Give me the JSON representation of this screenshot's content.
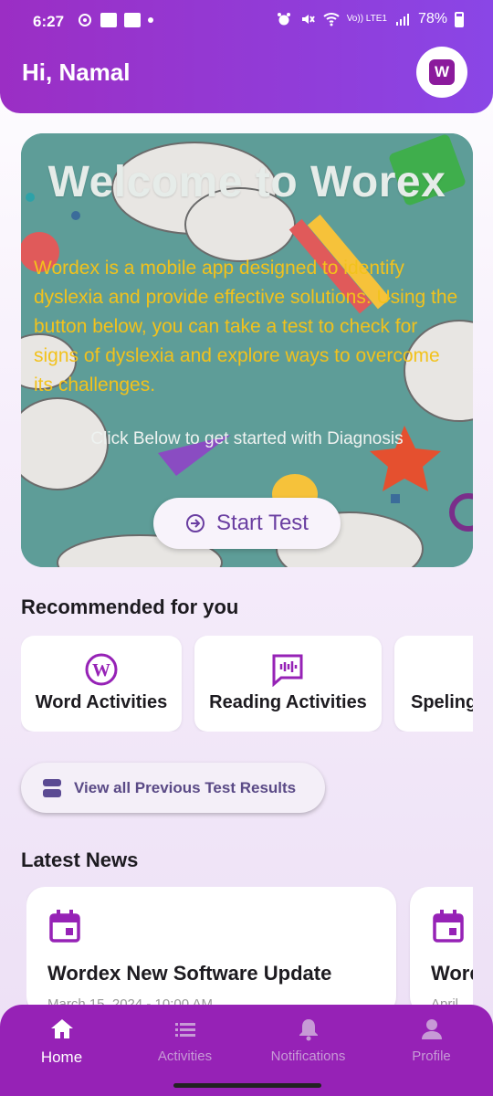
{
  "status_bar": {
    "time": "6:27",
    "network": "Vo)) LTE1",
    "battery": "78%"
  },
  "header": {
    "greeting": "Hi, Namal",
    "avatar_letter": "W"
  },
  "hero": {
    "title": "Welcome to Worex",
    "description": "Wordex is a mobile app designed to identify dyslexia and provide effective solutions. Using the button below, you can take a test to check for signs of dyslexia and explore ways to overcome its challenges.",
    "cta_text": "Click Below to get started with Diagnosis",
    "start_button": "Start Test"
  },
  "recommended": {
    "title": "Recommended for you",
    "items": [
      {
        "label": "Word Activities",
        "icon": "wordpress-icon"
      },
      {
        "label": "Reading Activities",
        "icon": "voice-chat-icon"
      },
      {
        "label": "Speling",
        "icon": ""
      }
    ]
  },
  "previous_results_button": "View all Previous Test Results",
  "news": {
    "title": "Latest News",
    "items": [
      {
        "title": "Wordex New Software Update",
        "date": "March 15, 2024 - 10:00 AM",
        "icon": "calendar-icon"
      },
      {
        "title": "Word",
        "date": "April",
        "icon": "calendar-icon"
      }
    ]
  },
  "bottom_nav": {
    "items": [
      {
        "label": "Home",
        "icon": "home-icon",
        "active": true
      },
      {
        "label": "Activities",
        "icon": "list-icon",
        "active": false
      },
      {
        "label": "Notifications",
        "icon": "bell-icon",
        "active": false
      },
      {
        "label": "Profile",
        "icon": "person-icon",
        "active": false
      }
    ]
  },
  "colors": {
    "primary": "#9622b6",
    "header_end": "#8a46e6",
    "hero_text": "#f2c21c",
    "accent": "#6a3ea1"
  }
}
